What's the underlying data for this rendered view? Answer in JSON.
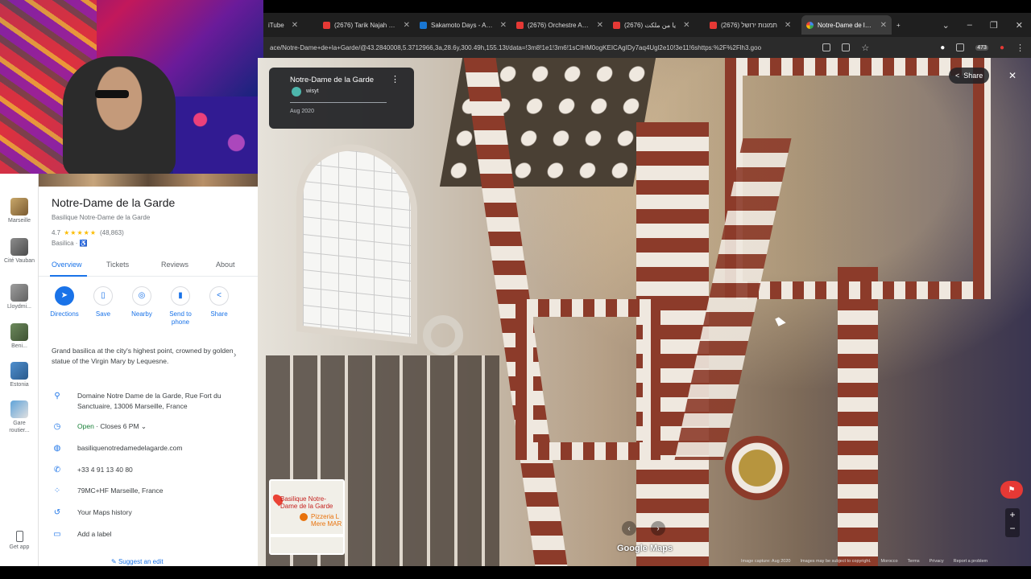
{
  "browser": {
    "tabs": [
      {
        "title": "iTube",
        "active": false
      },
      {
        "title": "(2676) Tarik Najah Caru",
        "active": false
      },
      {
        "title": "Sakamoto Days - Anim",
        "active": false
      },
      {
        "title": "(2676) Orchestre Asri -",
        "active": false
      },
      {
        "title": "(2676) يا من ملكت",
        "active": false
      },
      {
        "title": "(2676) תמונות ירושל",
        "active": false
      },
      {
        "title": "Notre-Dame de la Gard",
        "active": true
      }
    ],
    "new_tab": "+",
    "url": "ace/Notre-Dame+de+la+Garde/@43.2840008,5.3712966,3a,28.6y,300.49h,155.13t/data=!3m8!1e1!3m6!1sCIHM0ogKEICAgIDy7aq4Ugl2e10!3e11!6shttps:%2F%2Flh3.goo",
    "extension_badge": "473"
  },
  "rail": {
    "items": [
      {
        "label": "Marseille"
      },
      {
        "label": "Cité Vauban"
      },
      {
        "label": "Lloydmi..."
      },
      {
        "label": "Beni..."
      },
      {
        "label": "Estonia"
      },
      {
        "label": "Gare routier..."
      }
    ],
    "get_app": "Get app"
  },
  "place": {
    "title": "Notre-Dame de la Garde",
    "subtitle": "Basilique Notre-Dame de la Garde",
    "rating": "4.7",
    "stars": "★★★★★",
    "reviews_count": "(48,863)",
    "category": "Basilica · ",
    "accessibility": "♿",
    "tabs": [
      "Overview",
      "Tickets",
      "Reviews",
      "About"
    ],
    "actions": [
      "Directions",
      "Save",
      "Nearby",
      "Send to phone",
      "Share"
    ],
    "description": "Grand basilica at the city's highest point, crowned by golden statue of the Virgin Mary by Lequesne.",
    "address": "Domaine Notre Dame de la Garde, Rue Fort du Sanctuaire, 13006 Marseille, France",
    "hours_open": "Open",
    "hours_close": " · Closes 6 PM",
    "website": "basiliquenotredamedelagarde.com",
    "phone": "+33 4 91 13 40 80",
    "plus_code": "79MC+HF Marseille, France",
    "maps_history": "Your Maps history",
    "add_label": "Add a label",
    "suggest_edit": "Suggest an edit"
  },
  "streetview": {
    "card_title": "Notre-Dame de la Garde",
    "card_user": "wisyt",
    "card_date": "Aug 2020",
    "share": "Share",
    "minimap_label1": "Basilique Notre-Dame de la Garde",
    "minimap_label2": "Pizzeria L Mere MAR",
    "logo": "Google Maps",
    "footer": [
      "Image capture: Aug 2020",
      "Images may be subject to copyright.",
      "Morocco",
      "Terms",
      "Privacy",
      "Report a problem"
    ]
  }
}
